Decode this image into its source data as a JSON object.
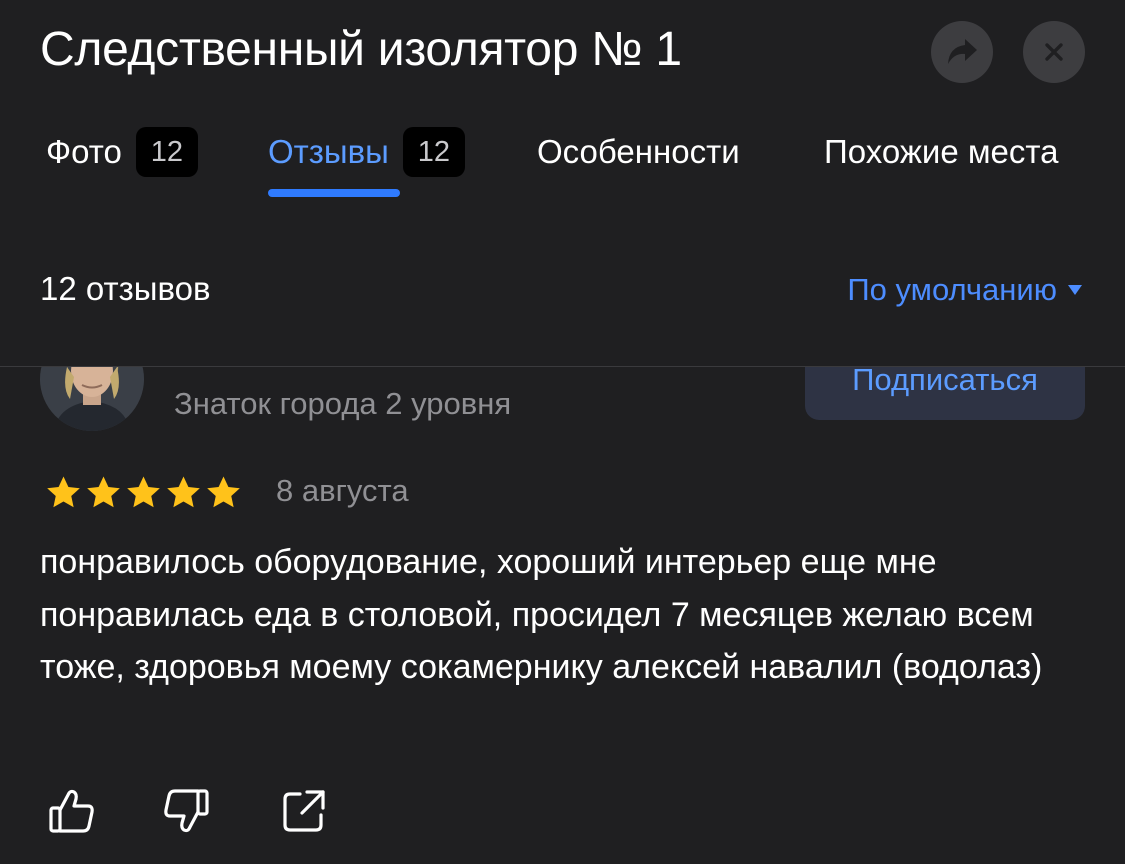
{
  "header": {
    "title": "Следственный изолятор № 1",
    "share_icon": "share-arrow-icon",
    "close_icon": "close-icon"
  },
  "tabs": [
    {
      "label": "Фото",
      "count": "12"
    },
    {
      "label": "Отзывы",
      "count": "12",
      "active": true
    },
    {
      "label": "Особенности"
    },
    {
      "label": "Похожие места"
    }
  ],
  "reviews_header": {
    "count_label": "12 отзывов",
    "sort_label": "По умолчанию"
  },
  "review": {
    "level": "Знаток города 2 уровня",
    "subscribe_label": "Подписаться",
    "rating": 5,
    "date": "8 августа",
    "text": "понравилось оборудование, хороший интерьер еще мне понравилась еда в столовой, просидел 7 месяцев желаю всем тоже, здоровья моему сокамернику алексей навалил (водолаз)"
  },
  "colors": {
    "background": "#1f1f21",
    "accent": "#2f7bff",
    "link": "#4d8dff",
    "star": "#ffc21a",
    "muted_text": "#909094"
  }
}
